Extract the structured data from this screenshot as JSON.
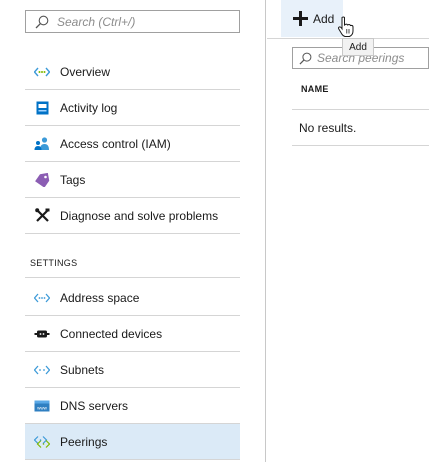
{
  "sidebar": {
    "search": {
      "placeholder": "Search (Ctrl+/)"
    },
    "items": [
      {
        "label": "Overview",
        "icon": "vnet-overview-icon"
      },
      {
        "label": "Activity log",
        "icon": "activity-log-icon"
      },
      {
        "label": "Access control (IAM)",
        "icon": "access-control-icon"
      },
      {
        "label": "Tags",
        "icon": "tag-icon"
      },
      {
        "label": "Diagnose and solve problems",
        "icon": "wrench-screwdriver-icon"
      }
    ],
    "settings_header": "SETTINGS",
    "settings_items": [
      {
        "label": "Address space",
        "icon": "vnet-address-space-icon"
      },
      {
        "label": "Connected devices",
        "icon": "connected-devices-icon"
      },
      {
        "label": "Subnets",
        "icon": "subnets-icon"
      },
      {
        "label": "DNS servers",
        "icon": "dns-servers-icon"
      },
      {
        "label": "Peerings",
        "icon": "peerings-icon",
        "selected": true
      }
    ]
  },
  "toolbar": {
    "add_label": "Add",
    "add_tooltip": "Add"
  },
  "peerings": {
    "search": {
      "placeholder": "Search peerings"
    },
    "columns": [
      "NAME"
    ],
    "empty_text": "No results."
  },
  "colors": {
    "selected_bg": "#dbeaf7",
    "hover_bg": "#e8f1fa",
    "vnet_blue": "#3c9ad8",
    "vnet_green": "#7fba00",
    "tag_purple": "#8b5db3",
    "log_blue": "#0072c6"
  }
}
